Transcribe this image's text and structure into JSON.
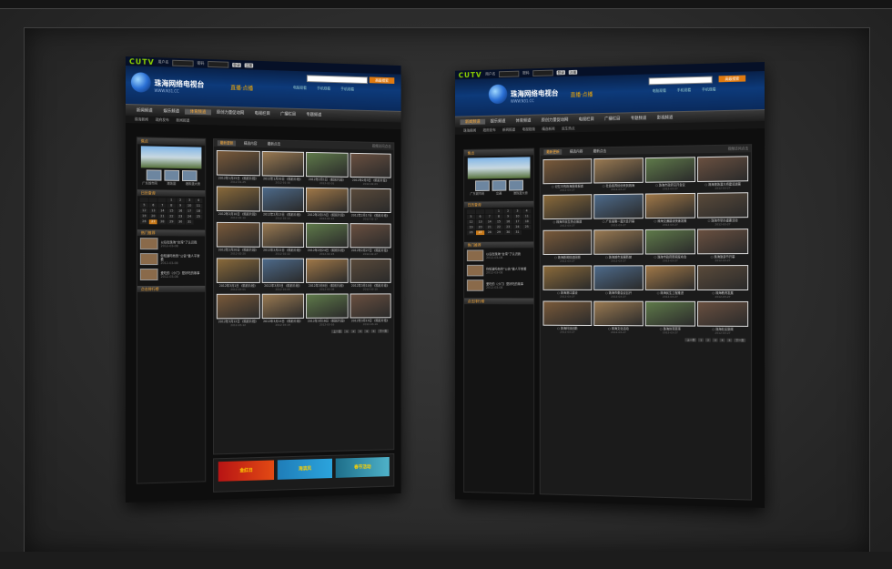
{
  "brand": {
    "logo": "CUTV",
    "site_title": "珠海网络电视台",
    "site_url": "WWW.N31.CC",
    "live_label": "直播·点播",
    "search_btn": "高级搜索"
  },
  "login": {
    "user_label": "用户名",
    "pass_label": "密码",
    "login_btn": "登录",
    "reg_btn": "注册"
  },
  "header_links": [
    "电脑观看",
    "手机观看",
    "手机观看"
  ],
  "nav": [
    "新闻频道",
    "娱乐频道",
    "体育频道",
    "原创力量促动网",
    "电视栏目",
    "广播栏目",
    "专题频道",
    "影视频道"
  ],
  "subnav": [
    "珠海新闻",
    "政府发布",
    "新闻报道",
    "电视视频",
    "精选新闻",
    "民生热点"
  ],
  "sidebar": {
    "focus_title": "焦点",
    "focus_caption": "广东城市网",
    "focus_thumbs": [
      "港珠澳",
      "交通",
      "港珠澳大桥"
    ],
    "calendar_title": "日历查询",
    "calendar": [
      "1",
      "2",
      "3",
      "4",
      "5",
      "6",
      "7",
      "8",
      "9",
      "10",
      "11",
      "12",
      "13",
      "14",
      "15",
      "16",
      "17",
      "18",
      "19",
      "20",
      "21",
      "22",
      "23",
      "24",
      "25",
      "26",
      "27",
      "28",
      "29",
      "30",
      "31"
    ],
    "calendar_highlight": "27",
    "hot_title": "热门推荐",
    "hot": [
      {
        "text": "以往在珠海“台湾”了认识我",
        "date": "2012-03-08"
      },
      {
        "text": "你知道吗有的“公告”做人平常看",
        "date": "2012-03-08"
      },
      {
        "text": "爱吃的（小门）是好吃的故事",
        "date": "2012-03-08"
      }
    ],
    "rank_title": "点击排行榜"
  },
  "main_tabs": [
    "最新更新",
    "精选内容",
    "最新点击"
  ],
  "main_extra": "视频访问点击",
  "left_items": [
    {
      "cap": "2012年1月25日 《精彩片段》",
      "date": "2012-01-25"
    },
    {
      "cap": "2012年1月30日 《精彩片段》",
      "date": "2012-01-30"
    },
    {
      "cap": "2012年2月1日 《精彩片段》",
      "date": "2012-02-01"
    },
    {
      "cap": "2012年2月3日 《精彩片段》",
      "date": "2012-02-03"
    },
    {
      "cap": "2012年2月10日 《精彩片段》",
      "date": "2012-02-10"
    },
    {
      "cap": "2012年2月13日 《精彩片段》",
      "date": "2012-02-13"
    },
    {
      "cap": "2012年2月15日 《精彩片段》",
      "date": "2012-02-15"
    },
    {
      "cap": "2012年2月17日 《精彩片段》",
      "date": "2012-02-17"
    },
    {
      "cap": "2012年2月20日 《精彩片段》",
      "date": "2012-02-20"
    },
    {
      "cap": "2012年2月22日 《精彩片段》",
      "date": "2012-02-22"
    },
    {
      "cap": "2012年2月24日 《精彩片段》",
      "date": "2012-02-24"
    },
    {
      "cap": "2012年2月27日 《精彩片段》",
      "date": "2012-02-27"
    },
    {
      "cap": "2012年3月1日 《精彩片段》",
      "date": "2012-03-01"
    },
    {
      "cap": "2012年3月5日 《精彩片段》",
      "date": "2012-03-05"
    },
    {
      "cap": "2012年3月8日 《精彩片段》",
      "date": "2012-03-08"
    },
    {
      "cap": "2012年3月10日 《精彩片段》",
      "date": "2012-03-10"
    },
    {
      "cap": "2012年3月12日 《精彩片段》",
      "date": "2012-03-12"
    },
    {
      "cap": "2012年3月14日 《精彩片段》",
      "date": "2012-03-14"
    },
    {
      "cap": "2012年3月16日 《精彩片段》",
      "date": "2012-03-16"
    },
    {
      "cap": "2012年3月19日 《精彩片段》",
      "date": "2012-03-19"
    }
  ],
  "right_items": [
    {
      "cap": "○ 记忆中的珠海新闻报道",
      "date": "2012-03-27"
    },
    {
      "cap": "○ 社会各界纷纷来到珠海",
      "date": "2012-03-27"
    },
    {
      "cap": "○ 珠海市政府召开会议",
      "date": "2012-03-27"
    },
    {
      "cap": "○ 珠海港珠澳大桥建设进展",
      "date": "2012-03-27"
    },
    {
      "cap": "○ 珠海市民生热点报道",
      "date": "2012-03-27"
    },
    {
      "cap": "○ 广东省第一届大会开幕",
      "date": "2012-03-27"
    },
    {
      "cap": "○ 珠海交通建设快速发展",
      "date": "2012-03-27"
    },
    {
      "cap": "○ 珠海市举办重要活动",
      "date": "2012-03-27"
    },
    {
      "cap": "○ 珠海新闻精选回顾",
      "date": "2012-03-27"
    },
    {
      "cap": "○ 珠海城市发展新貌",
      "date": "2012-03-27"
    },
    {
      "cap": "○ 珠海市政府新闻发布会",
      "date": "2012-03-27"
    },
    {
      "cap": "○ 珠海旅游节开幕",
      "date": "2012-03-27"
    },
    {
      "cap": "○ 珠海港口建设",
      "date": "2012-03-27"
    },
    {
      "cap": "○ 珠海市委会议召开",
      "date": "2012-03-27"
    },
    {
      "cap": "○ 珠海民生工程推进",
      "date": "2012-03-27"
    },
    {
      "cap": "○ 珠海教育发展",
      "date": "2012-03-27"
    },
    {
      "cap": "○ 珠海科技创新",
      "date": "2012-03-27"
    },
    {
      "cap": "○ 珠海文化活动",
      "date": "2012-03-27"
    },
    {
      "cap": "○ 珠海体育赛事",
      "date": "2012-03-27"
    },
    {
      "cap": "○ 珠海社区新闻",
      "date": "2012-03-27"
    }
  ],
  "pager": [
    "上一页",
    "1",
    "2",
    "3",
    "4",
    "5",
    "下一页"
  ],
  "ads": [
    "金红日",
    "海滨风",
    "春节活动"
  ],
  "colors": {
    "accent": "#ffae3a",
    "header_blue": "#0d3a7a",
    "bg": "#0e0e0e"
  }
}
